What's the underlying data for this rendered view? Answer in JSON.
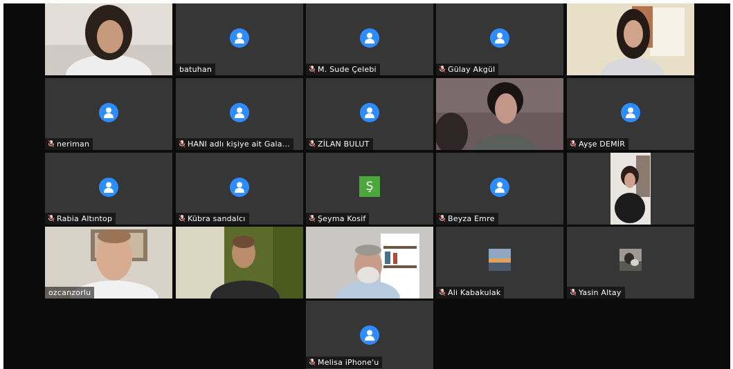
{
  "participants": [
    {
      "name": "",
      "muted": false
    },
    {
      "name": "batuhan",
      "muted": false
    },
    {
      "name": "M. Sude Çelebi",
      "muted": true
    },
    {
      "name": "Gülay Akgül",
      "muted": true
    },
    {
      "name": "",
      "muted": false
    },
    {
      "name": "neriman",
      "muted": true
    },
    {
      "name": "HANI adlı kişiye ait Gala...",
      "muted": true
    },
    {
      "name": "ZİLAN BULUT",
      "muted": true
    },
    {
      "name": "",
      "muted": false
    },
    {
      "name": "Ayşe DEMİR",
      "muted": true
    },
    {
      "name": "Rabia Altıntop",
      "muted": true
    },
    {
      "name": "Kübra sandalcı",
      "muted": true
    },
    {
      "name": "Şeyma Kosif",
      "muted": true,
      "avatar_letter": "Ş"
    },
    {
      "name": "Beyza Emre",
      "muted": true
    },
    {
      "name": "",
      "muted": false
    },
    {
      "name": "ozcanzorlu",
      "muted": false
    },
    {
      "name": "",
      "muted": false
    },
    {
      "name": "",
      "muted": false
    },
    {
      "name": "Ali Kabakulak",
      "muted": true
    },
    {
      "name": "Yasin Altay",
      "muted": true
    },
    {
      "name": "Melisa iPhone'u",
      "muted": true
    }
  ],
  "colors": {
    "avatar": "#2d8cff",
    "letter_avatar": "#4aa93a",
    "active_speaker": "#2d8cff"
  }
}
